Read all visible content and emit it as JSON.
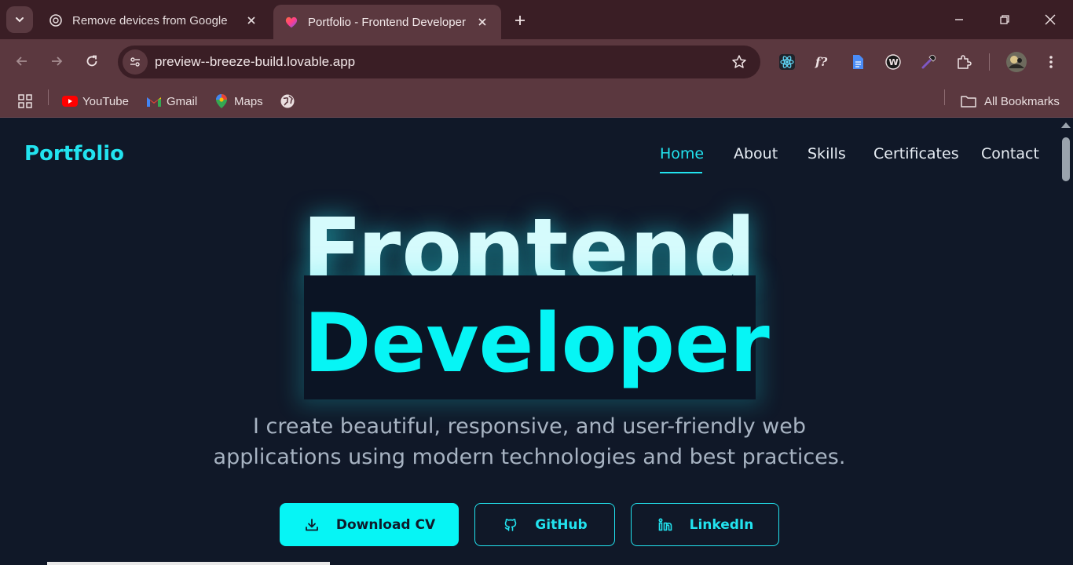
{
  "browser": {
    "tabs": [
      {
        "title": "Remove devices from Google",
        "favicon": "chatgpt-icon",
        "active": false
      },
      {
        "title": "Portfolio - Frontend Developer",
        "favicon": "lovable-heart-icon",
        "active": true
      }
    ],
    "url": "preview--breeze-build.lovable.app",
    "bookmarks": [
      {
        "label": "YouTube",
        "icon": "youtube-icon"
      },
      {
        "label": "Gmail",
        "icon": "gmail-icon"
      },
      {
        "label": "Maps",
        "icon": "maps-icon"
      }
    ],
    "all_bookmarks_label": "All Bookmarks",
    "extensions": [
      "react-devtools-icon",
      "whatfont-icon",
      "docs-icon",
      "wordtune-icon",
      "eyedropper-icon",
      "extensions-puzzle-icon"
    ]
  },
  "site": {
    "brand": "Portfolio",
    "nav": [
      {
        "label": "Home",
        "active": true
      },
      {
        "label": "About",
        "active": false
      },
      {
        "label": "Skills",
        "active": false
      },
      {
        "label": "Certificates",
        "active": false
      },
      {
        "label": "Contact",
        "active": false
      }
    ],
    "hero": {
      "line1": "Frontend",
      "line2": "Developer",
      "subtitle_line1": "I create beautiful, responsive, and user-friendly web",
      "subtitle_line2": "applications using modern technologies and best practices."
    },
    "buttons": {
      "download": "Download CV",
      "github": "GitHub",
      "linkedin": "LinkedIn"
    }
  },
  "colors": {
    "accent": "#22e3ef",
    "page_bg": "#101828",
    "chrome_tabbar": "#3a1e25",
    "chrome_toolbar": "#5b383f"
  }
}
